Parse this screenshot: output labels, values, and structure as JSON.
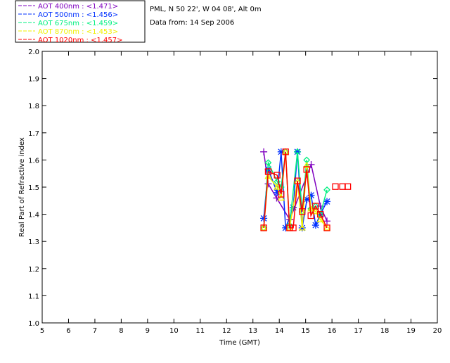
{
  "header": {
    "site": "PML, N 50 22', W 04 08', Alt 0m",
    "date": "Data from: 14 Sep 2006"
  },
  "chart_data": {
    "type": "scatter",
    "xlabel": "Time (GMT)",
    "ylabel": "Real Part of Refractive index",
    "xlim": [
      5,
      20
    ],
    "ylim": [
      1.0,
      2.0
    ],
    "xticks": [
      5,
      6,
      7,
      8,
      9,
      10,
      11,
      12,
      13,
      14,
      15,
      16,
      17,
      18,
      19,
      20
    ],
    "yticks": [
      "1.0",
      "1.1",
      "1.2",
      "1.3",
      "1.4",
      "1.5",
      "1.6",
      "1.7",
      "1.8",
      "1.9",
      "2.0"
    ],
    "legend_position": "top-left",
    "series": [
      {
        "name": "AOT  400nm : <1.471>",
        "color": "#7f00c0",
        "marker": "plus",
        "x": [
          13.41,
          13.58,
          13.9,
          14.4,
          15.21,
          15.56,
          15.81
        ],
        "y": [
          1.63,
          1.512,
          1.46,
          1.38,
          1.583,
          1.43,
          1.375
        ]
      },
      {
        "name": "AOT  500nm : <1.456>",
        "color": "#0030ff",
        "marker": "asterisk",
        "x": [
          13.41,
          13.58,
          13.92,
          14.07,
          14.24,
          14.53,
          14.69,
          14.87,
          15.05,
          15.21,
          15.38,
          15.56,
          15.81
        ],
        "y": [
          1.385,
          1.566,
          1.48,
          1.63,
          1.35,
          1.425,
          1.63,
          1.35,
          1.455,
          1.47,
          1.36,
          1.4,
          1.447
        ]
      },
      {
        "name": "AOT  675nm : <1.459>",
        "color": "#00f080",
        "marker": "diamond",
        "x": [
          13.41,
          13.58,
          13.92,
          14.07,
          14.24,
          14.39,
          14.69,
          14.87,
          15.04,
          15.2,
          15.38,
          15.56,
          15.81
        ],
        "y": [
          1.35,
          1.59,
          1.52,
          1.5,
          1.63,
          1.36,
          1.63,
          1.41,
          1.6,
          1.42,
          1.43,
          1.4,
          1.49
        ]
      },
      {
        "name": "AOT  870nm : <1.453>",
        "color": "#f0f000",
        "marker": "triangle",
        "x": [
          13.41,
          13.58,
          13.92,
          14.07,
          14.24,
          14.39,
          14.69,
          14.87,
          15.04,
          15.2,
          15.38,
          15.56,
          15.81
        ],
        "y": [
          1.35,
          1.54,
          1.5,
          1.46,
          1.63,
          1.35,
          1.52,
          1.35,
          1.58,
          1.42,
          1.41,
          1.38,
          1.35
        ]
      },
      {
        "name": "AOT 1020nm : <1.457>",
        "color": "#ff0000",
        "marker": "square",
        "x": [
          13.41,
          13.58,
          13.92,
          14.07,
          14.24,
          14.39,
          14.53,
          14.69,
          14.87,
          15.04,
          15.2,
          15.38,
          15.56,
          15.81,
          16.13,
          16.4,
          16.6
        ],
        "y": [
          1.35,
          1.557,
          1.544,
          1.474,
          1.63,
          1.35,
          1.35,
          1.523,
          1.41,
          1.565,
          1.395,
          1.43,
          1.4,
          1.35,
          1.502,
          1.502,
          1.502
        ]
      }
    ]
  }
}
